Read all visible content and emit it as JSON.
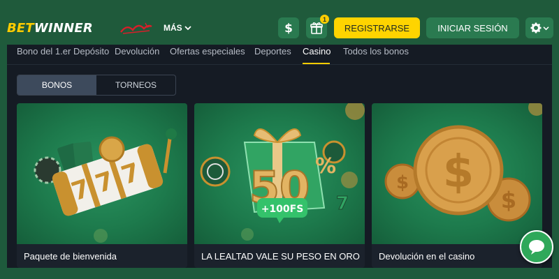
{
  "header": {
    "logo_part1": "BET",
    "logo_part2": "WINNER",
    "more_label": "MÁS",
    "deposit_icon": "dollar-icon",
    "gift_icon": "gift-icon",
    "gift_badge": "1",
    "register_label": "REGISTRARSE",
    "login_label": "INICIAR SESIÓN",
    "settings_icon": "gear-icon"
  },
  "tabs": [
    {
      "label": "Bono del 1.er Depósito",
      "active": false
    },
    {
      "label": "Devolución",
      "active": false
    },
    {
      "label": "Ofertas especiales",
      "active": false
    },
    {
      "label": "Deportes",
      "active": false
    },
    {
      "label": "Casino",
      "active": true
    },
    {
      "label": "Todos los bonos",
      "active": false
    }
  ],
  "segment": {
    "bonos": "BONOS",
    "torneos": "TORNEOS",
    "selected": "BONOS"
  },
  "cards": [
    {
      "title": "Paquete de bienvenida",
      "image": "slot-machine-777-illustration"
    },
    {
      "title": "LA LEALTAD VALE SU PESO EN ORO",
      "image": "gift-box-50-percent-illustration",
      "image_text": "50%",
      "image_badge": "+100FS"
    },
    {
      "title": "Devolución en el casino",
      "image": "gold-dollar-coins-illustration"
    }
  ],
  "colors": {
    "header_bg": "#1f5a3b",
    "accent_yellow": "#ffd400",
    "button_green": "#2a7a50",
    "content_bg": "#151b24",
    "chat_green": "#2fa85a"
  },
  "chat_icon": "chat-bubble-icon"
}
